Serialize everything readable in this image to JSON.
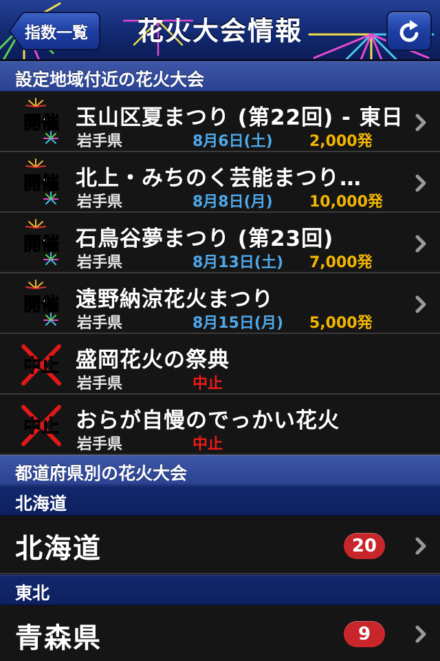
{
  "nav": {
    "title": "花火大会情報",
    "back_label": "指数一覧"
  },
  "nearby": {
    "header": "設定地域付近の花火大会",
    "events": [
      {
        "badge": "開催",
        "title": "玉山区夏まつり (第22回) - 東日…",
        "prefecture": "岩手県",
        "date": "8月6日(土)",
        "shots": "2,000発"
      },
      {
        "badge": "開催",
        "title": "北上・みちのく芸能まつり…",
        "prefecture": "岩手県",
        "date": "8月8日(月)",
        "shots": "10,000発"
      },
      {
        "badge": "開催",
        "title": "石鳥谷夢まつり (第23回)",
        "prefecture": "岩手県",
        "date": "8月13日(土)",
        "shots": "7,000発"
      },
      {
        "badge": "開催",
        "title": "遠野納涼花火まつり",
        "prefecture": "岩手県",
        "date": "8月15日(月)",
        "shots": "5,000発"
      },
      {
        "badge": "中止",
        "title": "盛岡花火の祭典",
        "prefecture": "岩手県",
        "status": "中止"
      },
      {
        "badge": "中止",
        "title": "おらが自慢のでっかい花火",
        "prefecture": "岩手県",
        "status": "中止"
      }
    ]
  },
  "by_prefecture": {
    "header": "都道府県別の花火大会",
    "regions": [
      {
        "region": "北海道",
        "items": [
          {
            "label": "北海道",
            "count": "20"
          }
        ]
      },
      {
        "region": "東北",
        "items": [
          {
            "label": "青森県",
            "count": "9"
          }
        ]
      }
    ]
  },
  "colors": {
    "date": "#4fa8ea",
    "shots": "#f2b600",
    "cancel": "#f01a1a",
    "count_badge": "#c8262a"
  }
}
